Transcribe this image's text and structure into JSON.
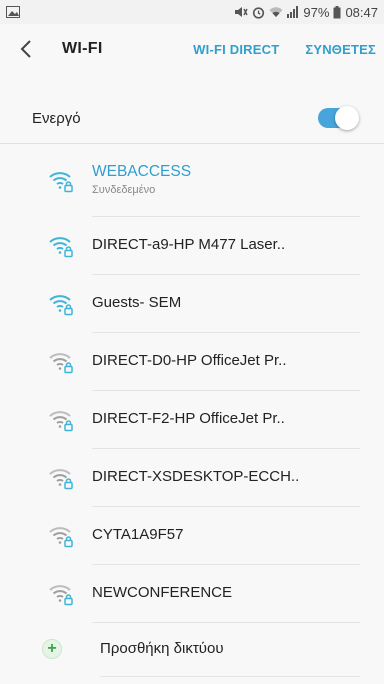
{
  "status_bar": {
    "battery_text": "97%",
    "time": "08:47",
    "icons": [
      "image-icon",
      "mute-icon",
      "alarm-icon",
      "wifi-icon",
      "signal-icon",
      "battery-icon"
    ]
  },
  "header": {
    "title": "WI-FI",
    "actions": [
      "WI-FI DIRECT",
      "ΣΥΝΘΕΤΕΣ"
    ]
  },
  "toggle": {
    "label": "Ενεργό",
    "state": "on"
  },
  "networks": [
    {
      "name": "WEBACCESS",
      "status": "Συνδεδεμένο",
      "connected": true,
      "locked": true,
      "signal": "strong"
    },
    {
      "name": "DIRECT-a9-HP M477 Laser..",
      "connected": false,
      "locked": true,
      "signal": "strong"
    },
    {
      "name": "Guests- SEM",
      "connected": false,
      "locked": true,
      "signal": "strong"
    },
    {
      "name": "DIRECT-D0-HP OfficeJet Pr..",
      "connected": false,
      "locked": true,
      "signal": "medium"
    },
    {
      "name": "DIRECT-F2-HP OfficeJet Pr..",
      "connected": false,
      "locked": true,
      "signal": "medium"
    },
    {
      "name": "DIRECT-XSDESKTOP-ECCH..",
      "connected": false,
      "locked": true,
      "signal": "medium"
    },
    {
      "name": "CYTA1A9F57",
      "connected": false,
      "locked": true,
      "signal": "medium"
    },
    {
      "name": "NEWCONFERENCE",
      "connected": false,
      "locked": true,
      "signal": "medium"
    }
  ],
  "add_network": {
    "label": "Προσθήκη δικτύου"
  },
  "colors": {
    "accent": "#2f9fcf",
    "wifi_strong": "#3fb4d8",
    "wifi_weak": "#9e9e9e",
    "add_green": "#3aa54a"
  }
}
